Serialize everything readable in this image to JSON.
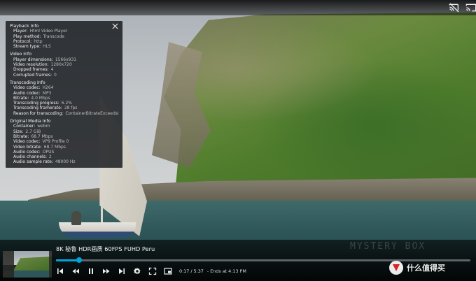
{
  "colors": {
    "accent": "#00a4dc",
    "panel_bg": "#14161a"
  },
  "topbar": {
    "icons": [
      "cast-disabled-icon",
      "cast-icon",
      "close-icon"
    ]
  },
  "playback_info": {
    "sections": [
      {
        "title": "Playback Info",
        "rows": [
          {
            "label": "Player:",
            "value": "Html Video Player"
          },
          {
            "label": "Play method:",
            "value": "Transcode"
          },
          {
            "label": "Protocol:",
            "value": "http"
          },
          {
            "label": "Stream type:",
            "value": "HLS"
          }
        ]
      },
      {
        "title": "Video Info",
        "rows": [
          {
            "label": "Player dimensions:",
            "value": "1566x931"
          },
          {
            "label": "Video resolution:",
            "value": "1280x720"
          },
          {
            "label": "Dropped frames:",
            "value": "4"
          },
          {
            "label": "Corrupted frames:",
            "value": "0"
          }
        ]
      },
      {
        "title": "Transcoding Info",
        "rows": [
          {
            "label": "Video codec:",
            "value": "H264"
          },
          {
            "label": "Audio codec:",
            "value": "MP3"
          },
          {
            "label": "Bitrate:",
            "value": "4.0 Mbps"
          },
          {
            "label": "Transcoding progress:",
            "value": "6.2%"
          },
          {
            "label": "Transcoding framerate:",
            "value": "28 fps"
          },
          {
            "label": "Reason for transcoding:",
            "value": "ContainerBitrateExceedsLimit"
          }
        ]
      },
      {
        "title": "Original Media Info",
        "rows": [
          {
            "label": "Container:",
            "value": "webm"
          },
          {
            "label": "Size:",
            "value": "2.7 GiB"
          },
          {
            "label": "Bitrate:",
            "value": "68.7 Mbps"
          },
          {
            "label": "Video codec:",
            "value": "VP9 Profile 0"
          },
          {
            "label": "Video bitrate:",
            "value": "68.7 Mbps"
          },
          {
            "label": "Audio codec:",
            "value": "OPUS"
          },
          {
            "label": "Audio channels:",
            "value": "2"
          },
          {
            "label": "Audio sample rate:",
            "value": "48000 Hz"
          }
        ]
      }
    ]
  },
  "osd": {
    "title": "8K 秘鲁 HDR画质 60FPS FUHD Peru",
    "watermark": "MYSTERY BOX",
    "progress": {
      "position_fraction": 0.055,
      "buffered_fraction": 0.062
    },
    "time": {
      "current": "0:17",
      "separator": "/",
      "duration": "5:37",
      "ends": "- Ends at 4:13 PM"
    },
    "brand": "什么值得买"
  }
}
